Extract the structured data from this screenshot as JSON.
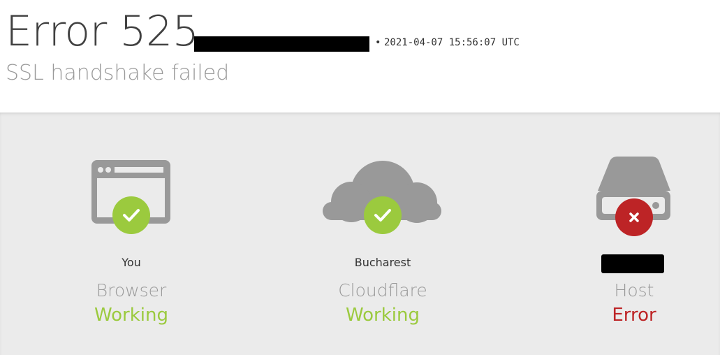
{
  "header": {
    "title": "Error 525",
    "subtitle": "SSL handshake failed",
    "separator": "•",
    "timestamp": "2021-04-07 15:56:07 UTC"
  },
  "nodes": [
    {
      "location": "You",
      "role": "Browser",
      "status": "Working",
      "state": "ok",
      "icon": "browser-icon"
    },
    {
      "location": "Bucharest",
      "role": "Cloudflare",
      "status": "Working",
      "state": "ok",
      "icon": "cloud-icon"
    },
    {
      "location": "",
      "role": "Host",
      "status": "Error",
      "state": "error",
      "icon": "server-icon"
    }
  ],
  "colors": {
    "ok": "#9bca3e",
    "error": "#bd2426",
    "icon_gray": "#999999",
    "panel_bg": "#ebebeb"
  }
}
